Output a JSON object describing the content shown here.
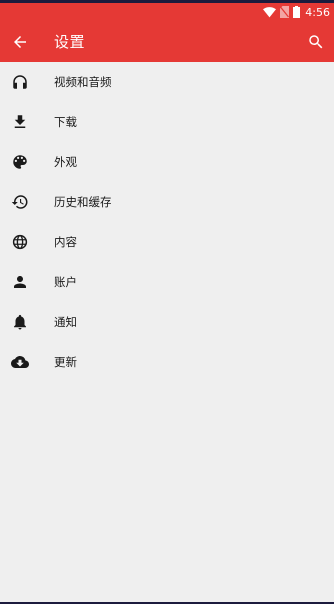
{
  "status_bar": {
    "time": "4:56",
    "icons": [
      "wifi-icon",
      "no-sim-icon",
      "battery-icon"
    ]
  },
  "app_bar": {
    "title": "设置",
    "back_icon": "arrow-back-icon",
    "search_icon": "search-icon"
  },
  "settings_items": [
    {
      "label": "视频和音频",
      "icon": "headphones-icon"
    },
    {
      "label": "下载",
      "icon": "download-icon"
    },
    {
      "label": "外观",
      "icon": "palette-icon"
    },
    {
      "label": "历史和缓存",
      "icon": "history-icon"
    },
    {
      "label": "内容",
      "icon": "globe-icon"
    },
    {
      "label": "账户",
      "icon": "person-icon"
    },
    {
      "label": "通知",
      "icon": "bell-icon"
    },
    {
      "label": "更新",
      "icon": "cloud-download-icon"
    }
  ],
  "colors": {
    "accent": "#e53935",
    "background": "#efefef",
    "icon": "#1a1a1a"
  }
}
